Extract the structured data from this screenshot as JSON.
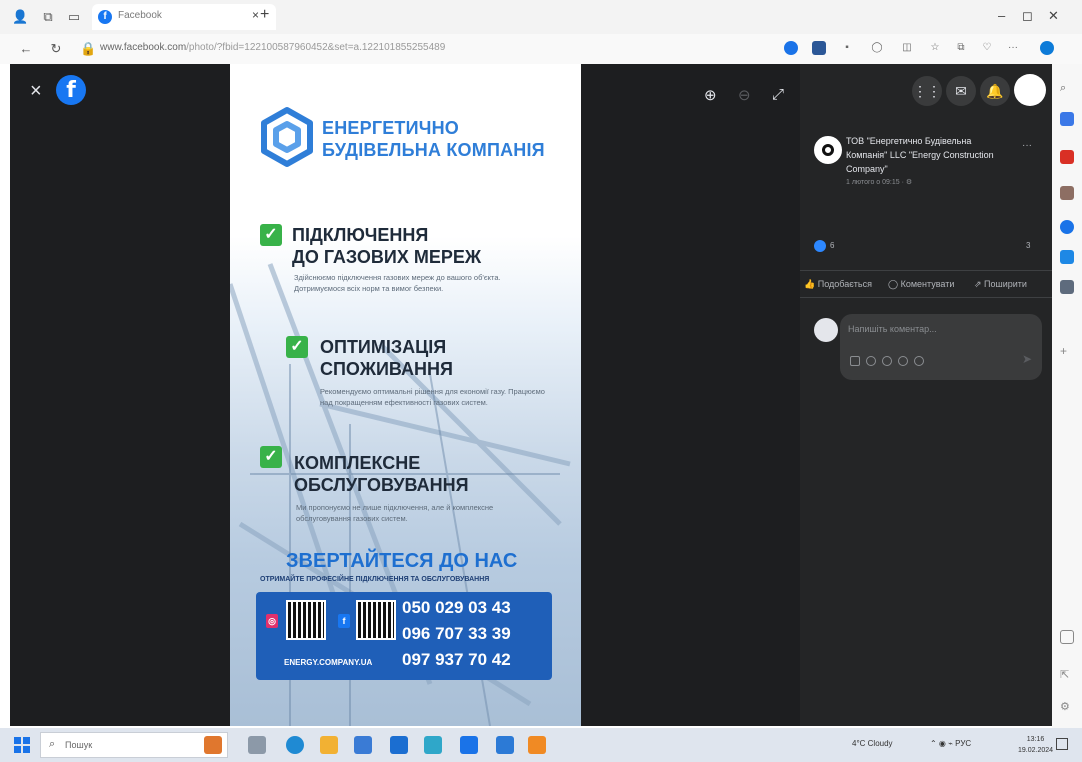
{
  "browser": {
    "tab_title": "Facebook",
    "tab_close": "×",
    "new_tab": "+",
    "url_host": "www.facebook.com",
    "url_rest": "/photo/?fbid=122100587960452&set=a.122101855255489",
    "win_min": "–",
    "win_max": "◻",
    "win_close": "✕"
  },
  "viewer": {
    "close_label": "×",
    "fb_logo": "f",
    "zoom_in": "⊕",
    "zoom_out": "⊖",
    "fullscreen": "⤢"
  },
  "poster": {
    "brand_line1": "ЕНЕРГЕТИЧНО",
    "brand_line2": "БУДІВЕЛЬНА КОМПАНІЯ",
    "services": [
      {
        "title_line1": "ПІДКЛЮЧЕННЯ",
        "title_line2": "ДО ГАЗОВИХ МЕРЕЖ",
        "desc": "Здійснюємо підключення газових мереж до вашого об'єкта. Дотримуємося всіх норм та вимог безпеки."
      },
      {
        "title_line1": "ОПТИМІЗАЦІЯ",
        "title_line2": "СПОЖИВАННЯ",
        "desc": "Рекомендуємо оптимальні рішення для економії газу. Працюємо над покращенням ефективності газових систем."
      },
      {
        "title_line1": "КОМПЛЕКСНЕ",
        "title_line2": "ОБСЛУГОВУВАННЯ",
        "desc": "Ми пропонуємо не лише підключення, але й комплексне обслуговування газових систем."
      }
    ],
    "cta": "ЗВЕРТАЙТЕСЯ ДО НАС",
    "cta_sub": "ОТРИМАЙТЕ ПРОФЕСІЙНЕ ПІДКЛЮЧЕННЯ ТА ОБСЛУГОВУВАННЯ",
    "phones": [
      "050 029 03 43",
      "096 707 33 39",
      "097 937 70 42"
    ],
    "website": "ENERGY.COMPANY.UA"
  },
  "panel": {
    "page_name": "ТОВ \"Енергетично Будівельна Компанія\" LLC \"Energy Construction Company\"",
    "post_time": "1 лютого о 09:15 · ⚙",
    "more": "···",
    "reactions_count": "6",
    "shares_count": "3",
    "actions": {
      "like": "Подобається",
      "comment": "Коментувати",
      "share": "Поширити"
    },
    "comment_placeholder": "Напишіть коментар..."
  },
  "taskbar": {
    "search_placeholder": "Пошук",
    "weather": "4°C Cloudy",
    "lang": "РУС",
    "time": "13:16",
    "date": "19.02.2024"
  },
  "colors": {
    "facebook_blue": "#1877f2",
    "brand_blue": "#2f7ed8",
    "check_green": "#38b249",
    "contact_blue": "#1f5fb8",
    "viewer_bg": "#1d1e20",
    "panel_bg": "#242526"
  }
}
